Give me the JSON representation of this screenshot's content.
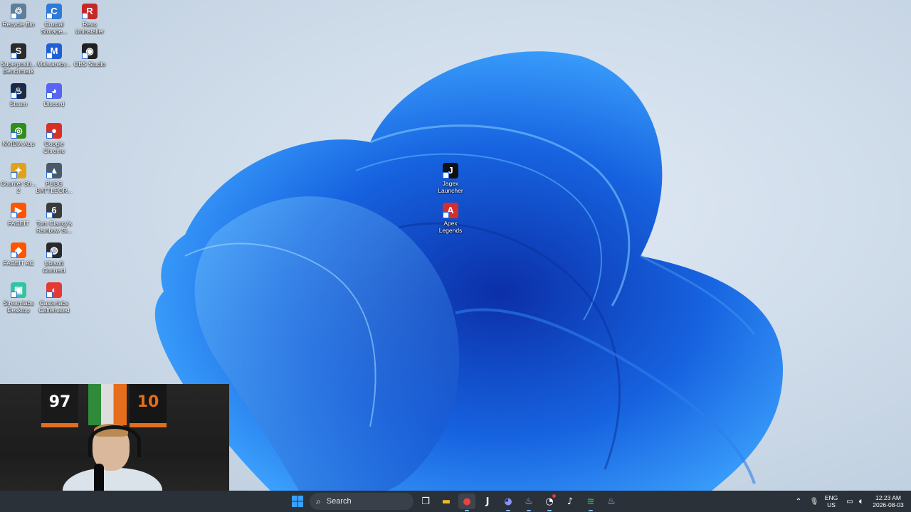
{
  "desktop": {
    "icons": [
      {
        "id": "recycle-bin",
        "label": "Recycle Bin",
        "glyph": "♲",
        "color": "#5f7f99"
      },
      {
        "id": "crucial-storage",
        "label": "Crucial Storage...",
        "glyph": "C",
        "color": "#2c7bd8"
      },
      {
        "id": "revo-uninstaller",
        "label": "Revo Uninstaller",
        "glyph": "R",
        "color": "#c62828"
      },
      {
        "id": "superposition",
        "label": "Superpositi... Benchmark",
        "glyph": "S",
        "color": "#2b2b2b"
      },
      {
        "id": "malwarebytes",
        "label": "Malwareby...",
        "glyph": "M",
        "color": "#1f5fd6"
      },
      {
        "id": "obs-studio",
        "label": "OBS Studio",
        "glyph": "◉",
        "color": "#202020"
      },
      {
        "id": "steam",
        "label": "Steam",
        "glyph": "♨",
        "color": "#1b2a45"
      },
      {
        "id": "discord",
        "label": "Discord",
        "glyph": "◕",
        "color": "#5865f2"
      },
      {
        "id": "nvidia-app",
        "label": "NVIDIA App",
        "glyph": "◎",
        "color": "#2f8f1a"
      },
      {
        "id": "google-chrome",
        "label": "Google Chrome",
        "glyph": "●",
        "color": "#d93025"
      },
      {
        "id": "counter-strike-2",
        "label": "Counter Str... 2",
        "glyph": "✦",
        "color": "#e0a21a"
      },
      {
        "id": "pubg",
        "label": "PUBG BATTLEGR...",
        "glyph": "▲",
        "color": "#4a5a66"
      },
      {
        "id": "faceit",
        "label": "FACEIT",
        "glyph": "▶",
        "color": "#ff5500"
      },
      {
        "id": "rainbow-six",
        "label": "Tom Clancy's Rainbow Si...",
        "glyph": "6",
        "color": "#3b3b3b"
      },
      {
        "id": "faceit-ac",
        "label": "FACEIT AC",
        "glyph": "◆",
        "color": "#ff5500"
      },
      {
        "id": "ubisoft-connect",
        "label": "Ubisoft Connect",
        "glyph": "◍",
        "color": "#2a2a2a"
      },
      {
        "id": "streamlabs-desktop",
        "label": "Streamlabs Desktop",
        "glyph": "▣",
        "color": "#31c3a2"
      },
      {
        "id": "casterlabs-caffeinated",
        "label": "Casterlabs Caffeinated",
        "glyph": "◐",
        "color": "#e53935"
      },
      {
        "id": "jagex-launcher",
        "label": "Jagex Launcher",
        "glyph": "J",
        "color": "#111111"
      },
      {
        "id": "apex-legends",
        "label": "Apex Legends",
        "glyph": "A",
        "color": "#d32f2f"
      }
    ]
  },
  "webcam": {
    "jersey_left": "97",
    "jersey_right": "10"
  },
  "taskbar": {
    "search_placeholder": "Search",
    "apps": [
      {
        "id": "start",
        "glyph": "⊞",
        "color": "#1e90ff"
      },
      {
        "id": "task-view",
        "glyph": "❐",
        "color": "#8a8a8a"
      },
      {
        "id": "file-explorer",
        "glyph": "▬",
        "color": "#f2b824"
      },
      {
        "id": "chrome",
        "glyph": "●",
        "color": "#d93025"
      },
      {
        "id": "jagex",
        "glyph": "J",
        "color": "#1a1a1a"
      },
      {
        "id": "discord",
        "glyph": "◕",
        "color": "#5865f2"
      },
      {
        "id": "steam",
        "glyph": "♨",
        "color": "#1b2a45"
      },
      {
        "id": "unknown-app",
        "glyph": "◔",
        "color": "#555555"
      },
      {
        "id": "tiktok",
        "glyph": "♪",
        "color": "#111111"
      },
      {
        "id": "spotify",
        "glyph": "≋",
        "color": "#1db954"
      },
      {
        "id": "steam-2",
        "glyph": "♨",
        "color": "#1b2a45"
      }
    ],
    "tray": {
      "language_line1": "ENG",
      "language_line2": "US",
      "time": "12:23 AM",
      "date": "2026-08-03"
    }
  }
}
